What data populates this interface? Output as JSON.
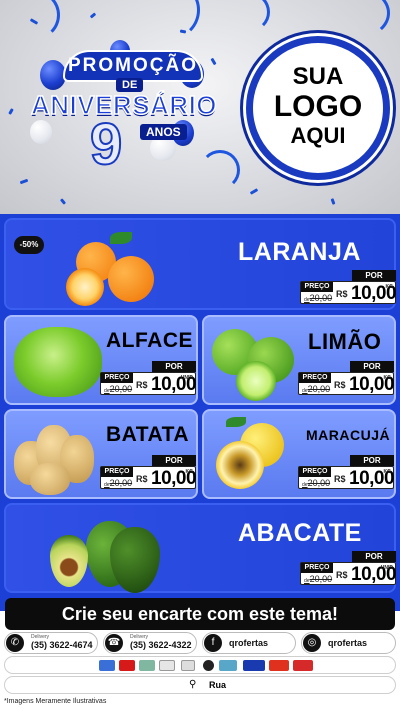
{
  "header": {
    "promo_word": "PROMOÇÃO",
    "promo_de": "DE",
    "promo_title": "ANIVERSÁRIO",
    "promo_number": "9",
    "promo_anos": "ANOS",
    "logo_line1": "SUA",
    "logo_line2": "LOGO",
    "logo_line3": "AQUI"
  },
  "colors": {
    "board_blue": "#1c3fd6",
    "card_light": "#7f9dff",
    "price_black": "#0d0d0d"
  },
  "products": [
    {
      "name": "LARANJA",
      "badge": "-50%",
      "por": "POR",
      "preco": "PREÇO",
      "old_prefix": "de",
      "old": "20,00",
      "currency": "R$",
      "value": "10,00",
      "unit": "KG"
    },
    {
      "name": "ALFACE",
      "por": "POR",
      "preco": "PREÇO",
      "old_prefix": "de",
      "old": "20,00",
      "currency": "R$",
      "value": "10,00",
      "unit": "UNID"
    },
    {
      "name": "LIMÃO",
      "por": "POR",
      "preco": "PREÇO",
      "old_prefix": "de",
      "old": "20,00",
      "currency": "R$",
      "value": "10,00",
      "unit": "KG"
    },
    {
      "name": "BATATA",
      "por": "POR",
      "preco": "PREÇO",
      "old_prefix": "de",
      "old": "20,00",
      "currency": "R$",
      "value": "10,00",
      "unit": "KG"
    },
    {
      "name": "MARACUJÁ",
      "por": "POR",
      "preco": "PREÇO",
      "old_prefix": "de",
      "old": "20,00",
      "currency": "R$",
      "value": "10,00",
      "unit": "KG"
    },
    {
      "name": "ABACATE",
      "por": "POR",
      "preco": "PREÇO",
      "old_prefix": "de",
      "old": "20,00",
      "currency": "R$",
      "value": "10,00",
      "unit": "UNID"
    }
  ],
  "cta": "Crie seu encarte com este tema!",
  "contacts": {
    "whatsapp_label": "Delivery",
    "whatsapp": "(35) 3622-4674",
    "phone_label": "Delivery",
    "phone": "(35) 3622-4322",
    "facebook": "qrofertas",
    "instagram": "qrofertas"
  },
  "address": "Rua",
  "disclaimer": "*Imagens Meramente Ilustrativas",
  "icons": [
    "whatsapp-icon",
    "phone-icon",
    "facebook-icon",
    "instagram-icon",
    "map-pin-icon"
  ]
}
